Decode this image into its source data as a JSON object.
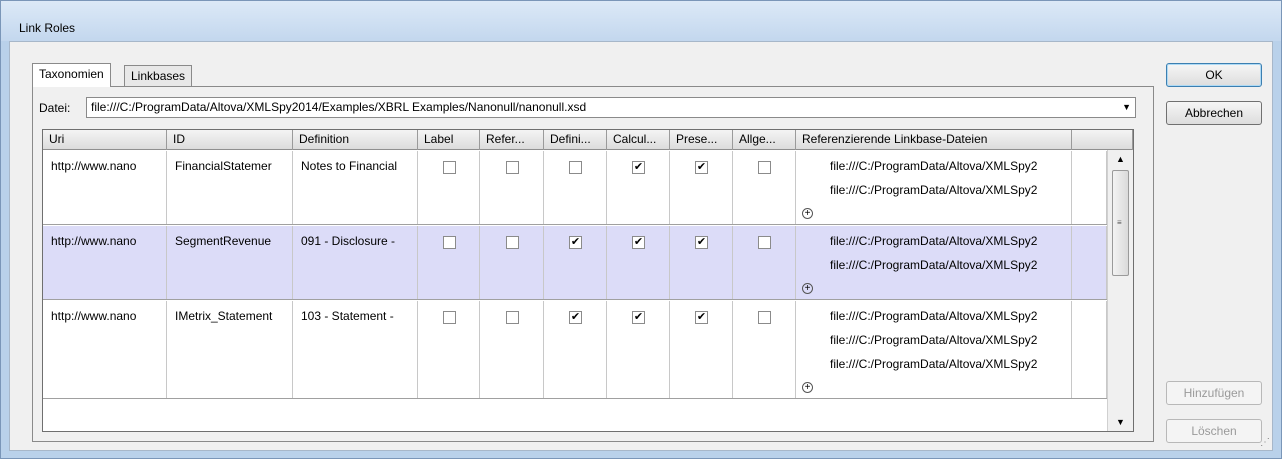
{
  "window": {
    "title": "Link Roles"
  },
  "tabs": [
    {
      "label": "Taxonomien",
      "active": true
    },
    {
      "label": "Linkbases",
      "active": false
    }
  ],
  "file": {
    "label": "Datei:",
    "value": "file:///C:/ProgramData/Altova/XMLSpy2014/Examples/XBRL Examples/Nanonull/nanonull.xsd"
  },
  "grid": {
    "columns": [
      "Uri",
      "ID",
      "Definition",
      "Label",
      "Refer...",
      "Defini...",
      "Calcul...",
      "Prese...",
      "Allge...",
      "Referenzierende Linkbase-Dateien"
    ],
    "rows": [
      {
        "uri": "http://www.nano",
        "id": "FinancialStatemer",
        "definition": "Notes to Financial",
        "checks": [
          false,
          false,
          false,
          true,
          true,
          false
        ],
        "linkbases": [
          "file:///C:/ProgramData/Altova/XMLSpy2",
          "file:///C:/ProgramData/Altova/XMLSpy2"
        ],
        "selected": false
      },
      {
        "uri": "http://www.nano",
        "id": "SegmentRevenue",
        "definition": "091 - Disclosure -",
        "checks": [
          false,
          false,
          true,
          true,
          true,
          false
        ],
        "linkbases": [
          "file:///C:/ProgramData/Altova/XMLSpy2",
          "file:///C:/ProgramData/Altova/XMLSpy2"
        ],
        "selected": true
      },
      {
        "uri": "http://www.nano",
        "id": "IMetrix_Statement",
        "definition": "103 - Statement -",
        "checks": [
          false,
          false,
          true,
          true,
          true,
          false
        ],
        "linkbases": [
          "file:///C:/ProgramData/Altova/XMLSpy2",
          "file:///C:/ProgramData/Altova/XMLSpy2",
          "file:///C:/ProgramData/Altova/XMLSpy2"
        ],
        "selected": false
      }
    ]
  },
  "buttons": {
    "ok": "OK",
    "cancel": "Abbrechen",
    "add": "Hinzufügen",
    "delete": "Löschen"
  },
  "icons": {
    "add_linkbase": "plus-circle-icon",
    "dropdown": "chevron-down-icon",
    "check": "checkmark-icon"
  },
  "colors": {
    "selected_row": "#dcdcf8",
    "title_bar": "#c3d7ee"
  }
}
